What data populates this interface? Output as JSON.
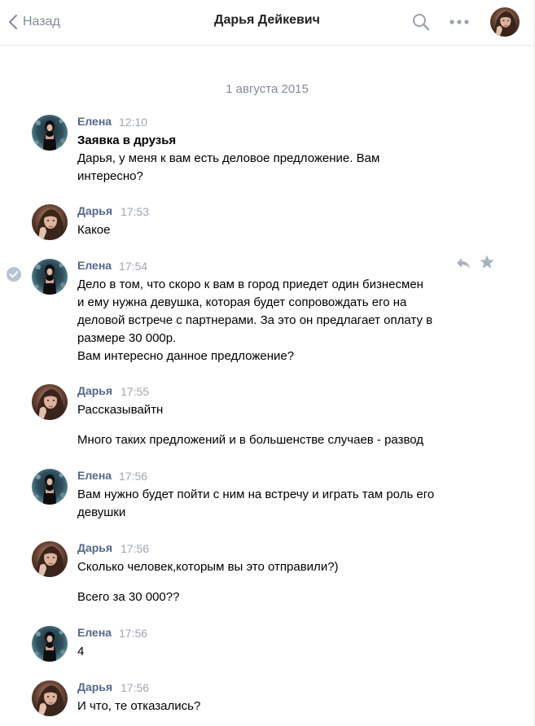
{
  "header": {
    "back_label": "Назад",
    "title": "Дарья Дейкевич",
    "icons": [
      "chevron-left-icon",
      "search-icon",
      "more-icon",
      "avatar"
    ]
  },
  "date_separator": "1 августа 2015",
  "colors": {
    "author": "#55688a",
    "time": "#a0a6b1",
    "meta_gray": "#828a99",
    "border": "#e7e8ec",
    "check": "#b5c3d6"
  },
  "messages": [
    {
      "author": "Елена",
      "time": "12:10",
      "title": "Заявка в друзья",
      "lines": [
        "Дарья, у меня к вам есть деловое предложение. Вам",
        "интересно?"
      ]
    },
    {
      "author": "Дарья",
      "time": "17:53",
      "lines": [
        "Какое"
      ]
    },
    {
      "author": "Елена",
      "time": "17:54",
      "lines": [
        "Дело в том, что скоро к вам в город приедет один бизнесмен",
        "и ему нужна девушка, которая будет сопровождать его на",
        "деловой встрече с партнерами. За это он предлагает оплату в",
        "размере 30 000р.",
        "Вам интересно данное предложение?"
      ]
    },
    {
      "author": "Дарья",
      "time": "17:55",
      "lines": [
        "Рассказывайтн",
        "Много таких предложений и в большенстве случаев - развод"
      ]
    },
    {
      "author": "Елена",
      "time": "17:56",
      "lines": [
        "Вам нужно будет пойти с ним на встречу и играть там роль его",
        "девушки"
      ]
    },
    {
      "author": "Дарья",
      "time": "17:56",
      "lines": [
        "Сколько человек,которым вы это отправили?)",
        "Всего за 30 000??"
      ]
    },
    {
      "author": "Елена",
      "time": "17:56",
      "lines": [
        "4"
      ]
    },
    {
      "author": "Дарья",
      "time": "17:56",
      "lines": [
        "И что, те отказались?"
      ]
    }
  ]
}
